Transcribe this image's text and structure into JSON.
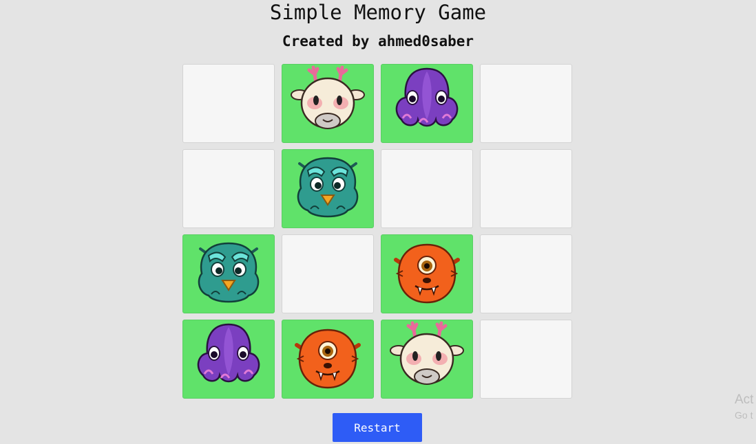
{
  "header": {
    "title": "Simple Memory Game",
    "subtitle": "Created by ahmed0saber"
  },
  "colors": {
    "background": "#e4e4e4",
    "card_hidden": "#f6f6f6",
    "card_flipped": "#60e26a",
    "restart_button": "#2e5cf6"
  },
  "board": {
    "rows": 4,
    "columns": 4,
    "cards": [
      {
        "state": "hidden",
        "creature": null
      },
      {
        "state": "flipped",
        "creature": "deer-creature-icon"
      },
      {
        "state": "flipped",
        "creature": "octopus-creature-icon"
      },
      {
        "state": "hidden",
        "creature": null
      },
      {
        "state": "hidden",
        "creature": null
      },
      {
        "state": "flipped",
        "creature": "teal-owl-creature-icon"
      },
      {
        "state": "hidden",
        "creature": null
      },
      {
        "state": "hidden",
        "creature": null
      },
      {
        "state": "flipped",
        "creature": "teal-owl-creature-icon"
      },
      {
        "state": "hidden",
        "creature": null
      },
      {
        "state": "flipped",
        "creature": "orange-cyclops-creature-icon"
      },
      {
        "state": "hidden",
        "creature": null
      },
      {
        "state": "flipped",
        "creature": "octopus-creature-icon"
      },
      {
        "state": "flipped",
        "creature": "orange-cyclops-creature-icon"
      },
      {
        "state": "flipped",
        "creature": "deer-creature-icon"
      },
      {
        "state": "hidden",
        "creature": null
      }
    ]
  },
  "controls": {
    "restart_label": "Restart"
  },
  "watermark": {
    "line1": "Act",
    "line2": "Go t"
  }
}
